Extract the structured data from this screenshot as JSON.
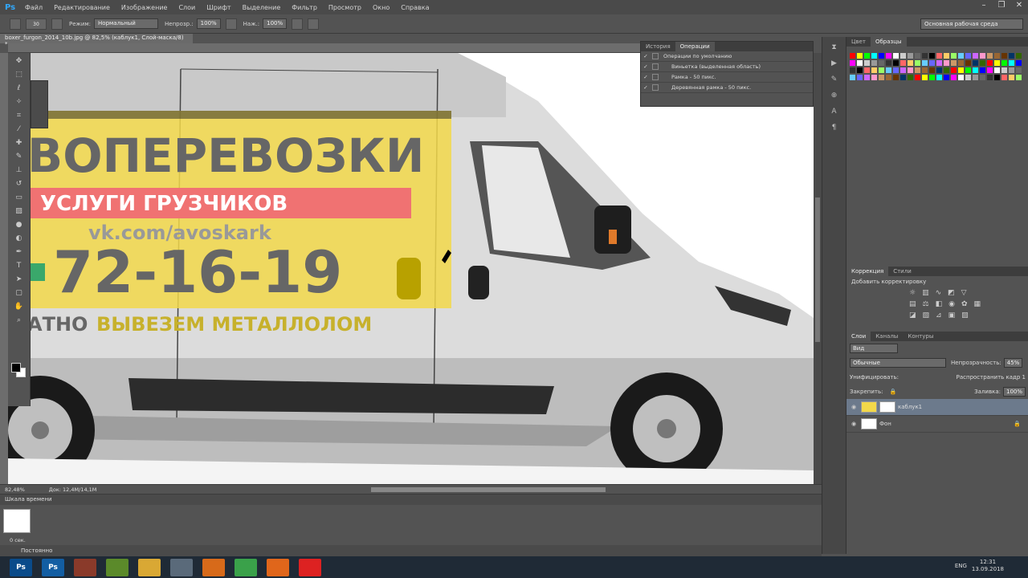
{
  "app": {
    "logo": "Ps"
  },
  "menu": [
    "Файл",
    "Редактирование",
    "Изображение",
    "Слои",
    "Шрифт",
    "Выделение",
    "Фильтр",
    "Просмотр",
    "Окно",
    "Справка"
  ],
  "window_controls": [
    "–",
    "❐",
    "✕"
  ],
  "options": {
    "size": "30",
    "mode_label": "Режим:",
    "mode_value": "Нормальный",
    "opacity_label": "Непрозр.:",
    "opacity_value": "100%",
    "pressure_label": "Наж.:",
    "pressure_value": "100%",
    "workspace": "Основная рабочая среда"
  },
  "document_tab": "boxer_furgon_2014_10b.jpg @ 82,5% (каблук1, Слой-маска/8) *",
  "canvas_text": {
    "line1": "ВОПЕРЕВОЗКИ",
    "line2": "УСЛУГИ ГРУЗЧИКОВ",
    "line3": "vk.com/avoskark",
    "line4": "72-16-19",
    "line5_a": "АТНО",
    "line5_b": "ВЫВЕЗЕМ МЕТАЛЛОЛОМ"
  },
  "status": {
    "zoom": "82,48%",
    "doc": "Док: 12,4M/14,1M"
  },
  "timeline": {
    "title": "Шкала времени",
    "frame_time": "0 сек.",
    "loop": "Постоянно"
  },
  "actions_panel": {
    "tabs": [
      "История",
      "Операции"
    ],
    "rows": [
      "Операции по умолчанию",
      "Виньетка (выделенная область)",
      "Рамка - 50 пикс.",
      "Деревянная рамка - 50 пикс."
    ]
  },
  "swatches_panel": {
    "tabs": [
      "Цвет",
      "Образцы"
    ]
  },
  "adjustments": {
    "tabs": [
      "Коррекция",
      "Стили"
    ],
    "title": "Добавить корректировку"
  },
  "layers_panel": {
    "tabs": [
      "Слои",
      "Каналы",
      "Контуры"
    ],
    "kind": "Вид",
    "blend": "Обычные",
    "opacity_label": "Непрозрачность:",
    "opacity_value": "45%",
    "unify_label": "Унифицировать:",
    "propagate": "Распространить кадр 1",
    "lock_label": "Закрепить:",
    "fill_label": "Заливка:",
    "fill_value": "100%",
    "layers": [
      {
        "name": "каблук1",
        "selected": true
      },
      {
        "name": "Фон",
        "selected": false
      }
    ]
  },
  "taskbar": {
    "lang": "ENG",
    "time": "12:31",
    "date": "13.09.2018"
  }
}
